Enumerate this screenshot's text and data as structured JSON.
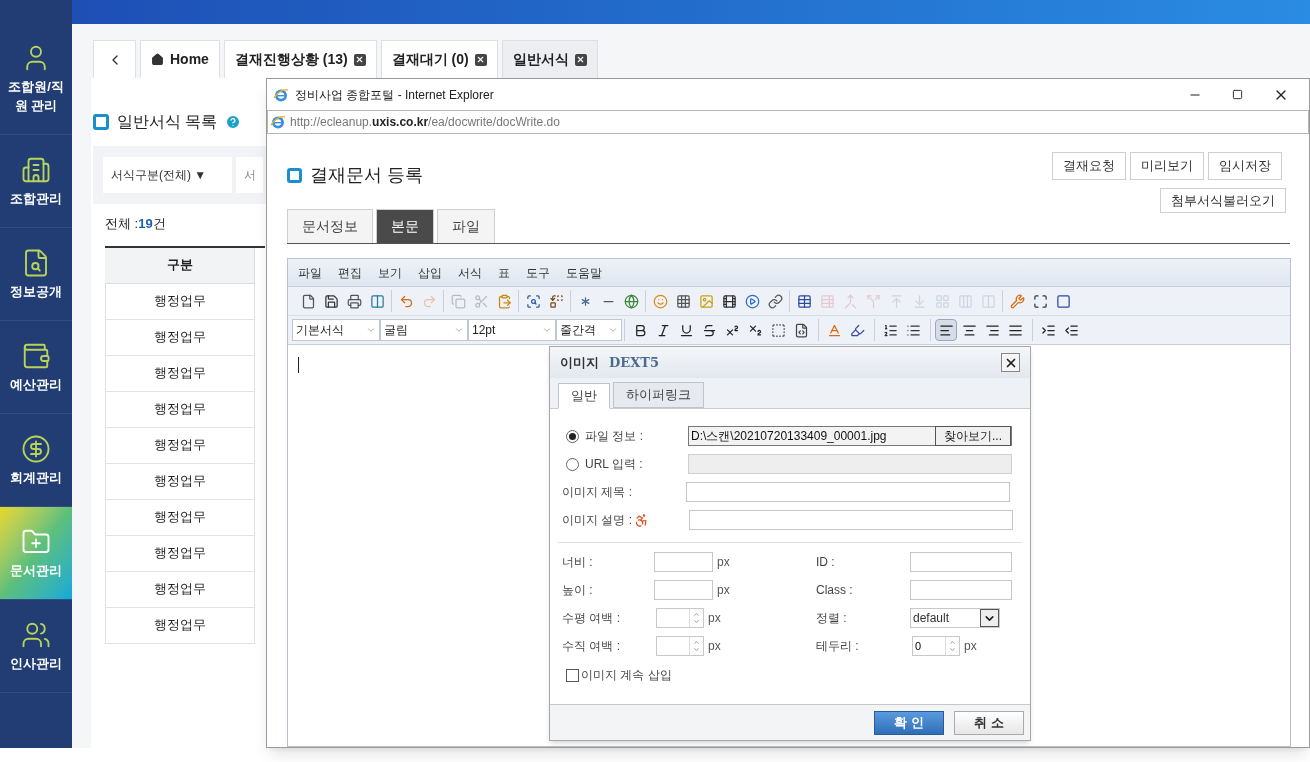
{
  "sidebar": {
    "items": [
      {
        "label": "조합원/직원 관리",
        "kind": "person",
        "selected": false
      },
      {
        "label": "조합관리",
        "kind": "building",
        "selected": false
      },
      {
        "label": "정보공개",
        "kind": "document",
        "selected": false
      },
      {
        "label": "예산관리",
        "kind": "budget",
        "selected": false
      },
      {
        "label": "회계관리",
        "kind": "accounting",
        "selected": false
      },
      {
        "label": "문서관리",
        "kind": "folder",
        "selected": true
      },
      {
        "label": "인사관리",
        "kind": "people",
        "selected": false
      }
    ]
  },
  "top_tabs": [
    {
      "kind": "back",
      "selected": false
    },
    {
      "kind": "home",
      "label": "Home",
      "closable": false,
      "selected": false
    },
    {
      "kind": "page",
      "label": "결재진행상황 (13)",
      "closable": true,
      "selected": false
    },
    {
      "kind": "page",
      "label": "결재대기 (0)",
      "closable": true,
      "selected": false
    },
    {
      "kind": "page",
      "label": "일반서식",
      "closable": true,
      "selected": true
    }
  ],
  "page": {
    "title": "일반서식 목록",
    "filter": {
      "category": "서식구분(전체) ▼",
      "search": "서"
    },
    "total_label": "전체 : ",
    "total_count": "19",
    "total_unit": "건",
    "table": {
      "columns": [
        "구분"
      ],
      "rows": [
        "행정업무",
        "행정업무",
        "행정업무",
        "행정업무",
        "행정업무",
        "행정업무",
        "행정업무",
        "행정업무",
        "행정업무",
        "행정업무"
      ]
    }
  },
  "browser": {
    "title": "정비사업 종합포털 - Internet Explorer",
    "url": "http://ecleanup.**uxis.co.kr**/ea/docwrite/docWrite.do"
  },
  "form": {
    "title": "결재문서 등록",
    "actions": [
      "결재요청",
      "미리보기",
      "임시저장"
    ],
    "load_button": "첨부서식불러오기",
    "tabs": [
      {
        "label": "문서정보",
        "selected": false
      },
      {
        "label": "본문",
        "selected": true
      },
      {
        "label": "파일",
        "selected": false
      }
    ]
  },
  "editor": {
    "menu": [
      "파일",
      "편집",
      "보기",
      "삽입",
      "서식",
      "표",
      "도구",
      "도움말"
    ],
    "toolbar_1": [
      [
        {
          "kind": "new",
          "disabled": false
        },
        {
          "kind": "save",
          "disabled": false
        },
        {
          "kind": "print",
          "disabled": false
        },
        {
          "kind": "preview",
          "disabled": false
        }
      ],
      [
        {
          "kind": "undo",
          "disabled": false
        },
        {
          "kind": "redo",
          "disabled": true
        }
      ],
      [
        {
          "kind": "copy",
          "disabled": true
        },
        {
          "kind": "cut",
          "disabled": true
        },
        {
          "kind": "paste",
          "disabled": false
        }
      ],
      [
        {
          "kind": "find",
          "disabled": false
        },
        {
          "kind": "replace",
          "disabled": false
        }
      ],
      [
        {
          "kind": "symbol",
          "disabled": false
        },
        {
          "kind": "rule",
          "disabled": false
        },
        {
          "kind": "globe",
          "disabled": false
        }
      ],
      [
        {
          "kind": "emoji",
          "disabled": false
        },
        {
          "kind": "pattern",
          "disabled": false
        },
        {
          "kind": "image",
          "disabled": false
        },
        {
          "kind": "video",
          "disabled": false
        },
        {
          "kind": "media",
          "disabled": false
        },
        {
          "kind": "link",
          "disabled": false
        }
      ],
      [
        {
          "kind": "table",
          "disabled": false
        },
        {
          "kind": "cellprops",
          "disabled": true
        },
        {
          "kind": "merge",
          "disabled": true
        },
        {
          "kind": "split",
          "disabled": true
        },
        {
          "kind": "rowabove",
          "disabled": true
        },
        {
          "kind": "rowbelow",
          "disabled": true
        },
        {
          "kind": "grid",
          "disabled": true
        },
        {
          "kind": "colinsert",
          "disabled": true
        },
        {
          "kind": "coldelete",
          "disabled": true
        }
      ],
      [
        {
          "kind": "tools",
          "disabled": false
        },
        {
          "kind": "fullscreen",
          "disabled": false
        },
        {
          "kind": "dext",
          "disabled": false
        }
      ]
    ],
    "styles": [
      "기본서식",
      "굴림",
      "12pt",
      "줄간격"
    ],
    "toolbar_2": [
      [
        {
          "kind": "bold",
          "selected": false
        },
        {
          "kind": "italic",
          "selected": false
        },
        {
          "kind": "underline",
          "selected": false
        },
        {
          "kind": "strike",
          "selected": false
        },
        {
          "kind": "superscript",
          "selected": false
        },
        {
          "kind": "subscript",
          "selected": false
        },
        {
          "kind": "textbox",
          "selected": false
        },
        {
          "kind": "css",
          "selected": false
        }
      ],
      [
        {
          "kind": "fontcolor",
          "selected": false
        },
        {
          "kind": "bgcolor",
          "selected": false
        }
      ],
      [
        {
          "kind": "olist",
          "selected": false
        },
        {
          "kind": "ulist",
          "selected": false
        }
      ],
      [
        {
          "kind": "alignleft",
          "selected": true
        },
        {
          "kind": "aligncenter",
          "selected": false
        },
        {
          "kind": "alignright",
          "selected": false
        },
        {
          "kind": "justify",
          "selected": false
        }
      ],
      [
        {
          "kind": "indent",
          "selected": false
        },
        {
          "kind": "outdent",
          "selected": false
        }
      ]
    ]
  },
  "dialog": {
    "title": "이미지",
    "brand": "DEXT5",
    "tabs": [
      {
        "label": "일반",
        "selected": true
      },
      {
        "label": "하이퍼링크",
        "selected": false
      }
    ],
    "sources": [
      {
        "label": "파일 정보 :",
        "selected": true,
        "value": "D:\\스캔\\20210720133409_00001.jpg",
        "button": "찾아보기...",
        "disabled": false
      },
      {
        "label": "URL 입력 :",
        "selected": false,
        "disabled": true
      }
    ],
    "title_label": "이미지 제목 :",
    "description_label": "이미지 설명 :",
    "left_fields": [
      {
        "label": "너비 :",
        "kind": "text",
        "unit": "px"
      },
      {
        "label": "높이 :",
        "kind": "text",
        "unit": "px"
      },
      {
        "label": "수평 여백 :",
        "kind": "spinner",
        "unit": "px"
      },
      {
        "label": "수직 여백 :",
        "kind": "spinner",
        "unit": "px"
      }
    ],
    "right_fields": [
      {
        "label": "ID :",
        "kind": "text"
      },
      {
        "label": "Class :",
        "kind": "text"
      },
      {
        "label": "정렬 :",
        "kind": "select",
        "value": "default"
      },
      {
        "label": "테두리 :",
        "kind": "spinner",
        "value": "0",
        "unit": "px"
      }
    ],
    "keep_inserting": {
      "label": "이미지 계속 삽입",
      "checked": false
    },
    "buttons": [
      {
        "label": "확 인",
        "kind": "primary"
      },
      {
        "label": "취 소",
        "kind": "secondary"
      }
    ]
  }
}
